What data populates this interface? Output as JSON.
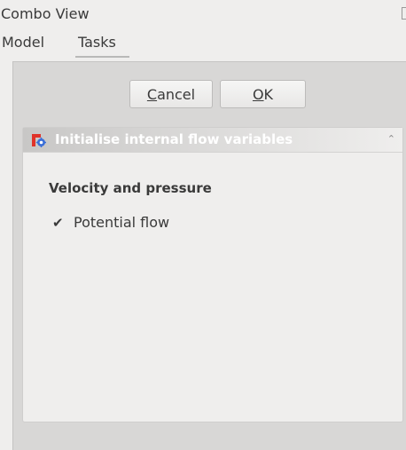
{
  "window": {
    "title": "Combo View"
  },
  "tabs": [
    {
      "label": "Model",
      "active": false
    },
    {
      "label": "Tasks",
      "active": true
    }
  ],
  "buttons": {
    "cancel": {
      "accel": "C",
      "rest": "ancel"
    },
    "ok": {
      "accel": "O",
      "rest": "K"
    }
  },
  "task": {
    "title": "Initialise internal flow variables",
    "icon": "freecad-cfd-icon",
    "collapse_icon": "double-chevron-up-icon",
    "group_title": "Velocity and pressure",
    "checkbox": {
      "label": "Potential flow",
      "checked": true
    }
  },
  "colors": {
    "header_text": "#ffffff",
    "icon_red": "#e0332a",
    "icon_blue": "#3a6fd8"
  }
}
